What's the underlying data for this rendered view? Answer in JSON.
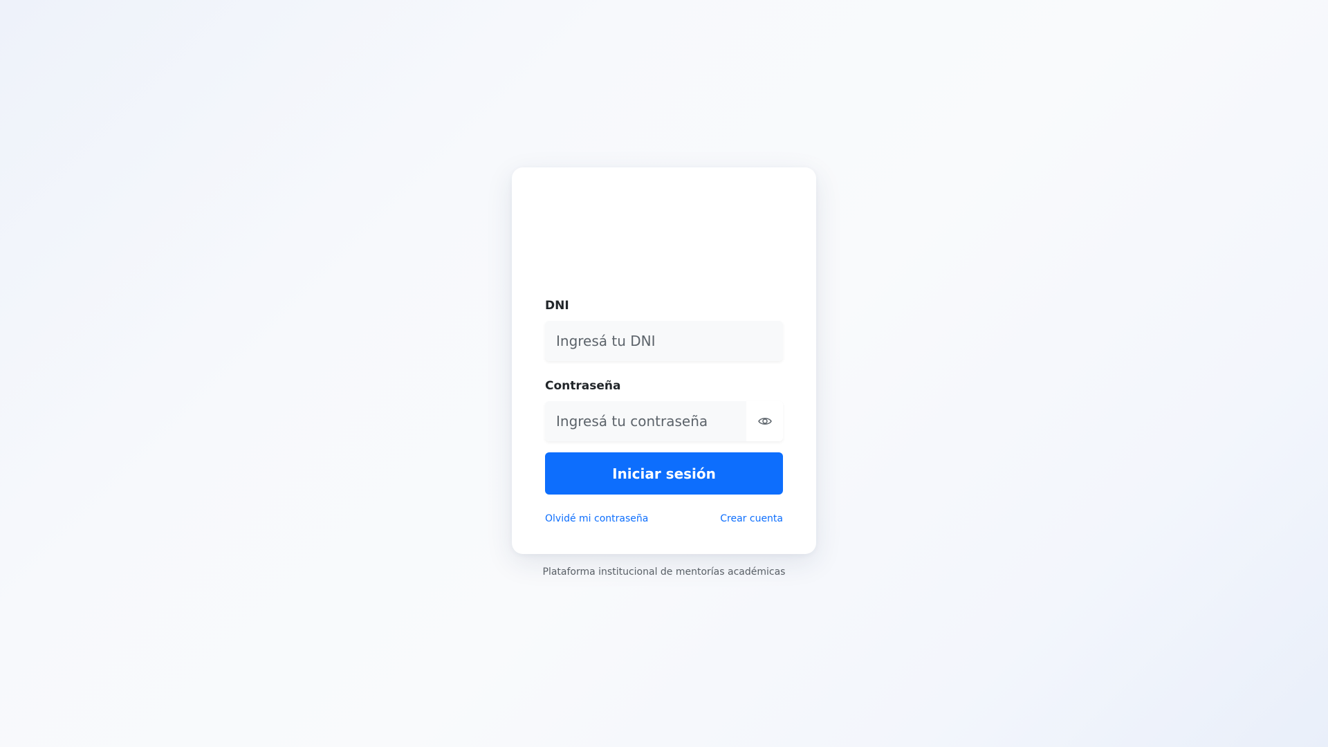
{
  "login": {
    "dni_label": "DNI",
    "dni_placeholder": "Ingresá tu DNI",
    "password_label": "Contraseña",
    "password_placeholder": "Ingresá tu contraseña",
    "show_password_icon": "eye-icon",
    "submit_label": "Iniciar sesión",
    "forgot_password_link": "Olvidé mi contraseña",
    "create_account_link": "Crear cuenta"
  },
  "footer": {
    "text": "Plataforma institucional de mentorías académicas"
  },
  "colors": {
    "primary": "#0d6efd",
    "input_bg": "#f8f9fa",
    "card_bg": "#ffffff"
  }
}
